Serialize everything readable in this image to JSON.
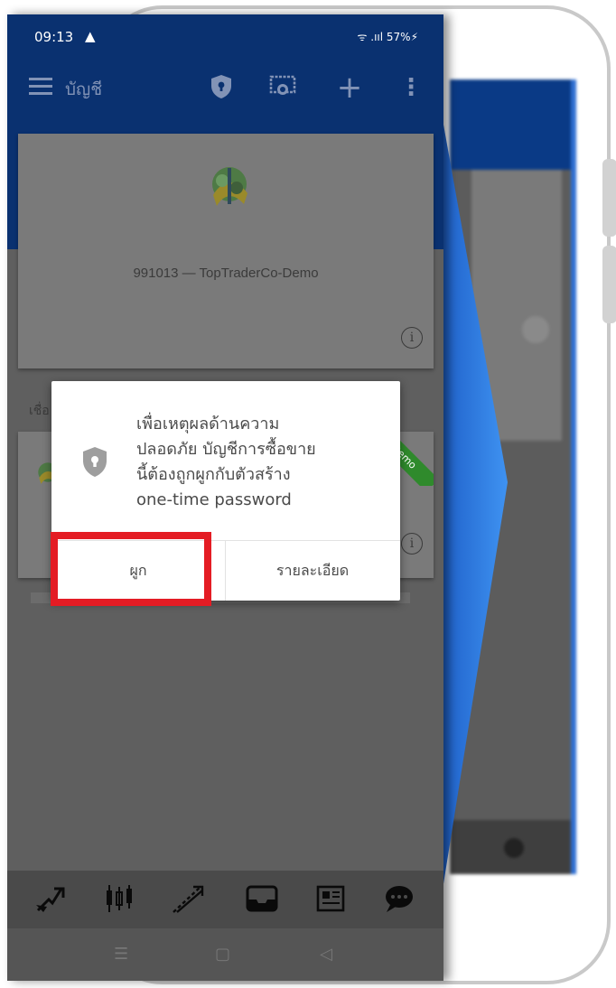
{
  "status_bar": {
    "time": "09:13",
    "warning_symbol": "▲",
    "right_indicators": "ᯤ .ııl 57%⚡"
  },
  "app_bar": {
    "title": "บัญชี",
    "icons": [
      "menu-icon",
      "shield-icon",
      "certificate-icon",
      "add-icon",
      "more-vertical-icon"
    ],
    "add_symbol": "+",
    "more_symbol": "⋮"
  },
  "accounts": [
    {
      "name": "991013 — TopTraderCo-Demo",
      "info_symbol": "i"
    },
    {
      "badge": "Demo",
      "info_symbol": "i"
    }
  ],
  "section_label": "เชื่อ",
  "dialog": {
    "message": "เพื่อเหตุผลด้านความ\nปลอดภัย บัญชีการซื้อขาย\nนี้ต้องถูกผูกกับตัวสร้าง\none-time password",
    "primary_button": "ผูก",
    "secondary_button": "รายละเอียด"
  },
  "bottom_nav": [
    "quotes-icon",
    "chart-icon",
    "trade-icon",
    "history-icon",
    "news-icon",
    "chat-icon"
  ],
  "system_nav": {
    "recent": "☰",
    "home": "▢",
    "back": "◁"
  },
  "colors": {
    "app_bar": "#0a3170",
    "highlight": "#e41c24",
    "demo_ribbon": "#2f8a2c",
    "wedge": "#2f7fe8"
  }
}
